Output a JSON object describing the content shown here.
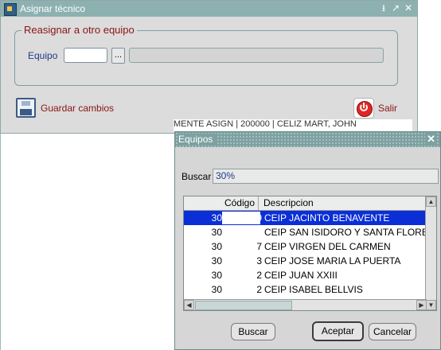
{
  "main_window": {
    "title": "Asignar técnico",
    "controls": [
      "⭳",
      "↗",
      "✕"
    ],
    "group_title": "Reasignar a otro equipo",
    "equipo_label": "Equipo",
    "equipo_value": "",
    "lov_button": "...",
    "equipo_desc": "",
    "save_label": "Guardar cambios",
    "exit_label": "Salir"
  },
  "background": {
    "row_fragment": "MENTE ASIGN | 200000 | CELIZ MART, JOHN"
  },
  "lov_dialog": {
    "title": "Equipos",
    "close": "✕",
    "search_label": "Buscar",
    "search_value": "30%",
    "columns": [
      "Código",
      "Descripcion"
    ],
    "rows": [
      {
        "code": "30",
        "tail": "9",
        "desc": "CEIP JACINTO BENAVENTE",
        "selected": true
      },
      {
        "code": "30",
        "tail": "",
        "desc": "CEIP SAN ISIDORO Y SANTA FLORE",
        "selected": false
      },
      {
        "code": "30",
        "tail": "7",
        "desc": "CEIP VIRGEN DEL CARMEN",
        "selected": false
      },
      {
        "code": "30",
        "tail": "3",
        "desc": "CEIP JOSE MARIA LA PUERTA",
        "selected": false
      },
      {
        "code": "30",
        "tail": "2",
        "desc": "CEIP JUAN XXIII",
        "selected": false
      },
      {
        "code": "30",
        "tail": "2",
        "desc": "CEIP  ISABEL BELLVIS",
        "selected": false
      }
    ],
    "buttons": {
      "buscar": "Buscar",
      "aceptar": "Aceptar",
      "cancelar": "Cancelar"
    }
  }
}
